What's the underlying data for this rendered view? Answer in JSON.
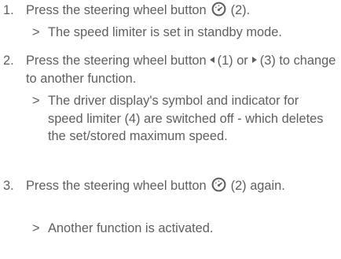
{
  "steps": [
    {
      "number": "1.",
      "parts": [
        "Press the steering wheel button",
        "(2)."
      ],
      "result": "The speed limiter is set in standby mode."
    },
    {
      "number": "2.",
      "parts": [
        "Press the steering wheel button",
        "(1) or",
        "(3) to change to another function."
      ],
      "result": "The driver display's symbol and indicator for speed limiter (4) are switched off - which deletes the set/stored maximum speed."
    },
    {
      "number": "3.",
      "parts": [
        "Press the steering wheel button",
        "(2) again."
      ],
      "result": "Another function is activated."
    }
  ],
  "result_marker": ">",
  "icons": {
    "speed_limiter_button": "speedometer-icon",
    "left_button": "left-arrow-icon",
    "right_button": "right-arrow-icon"
  },
  "colors": {
    "text": "#5f5f5f",
    "background": "#ffffff"
  }
}
